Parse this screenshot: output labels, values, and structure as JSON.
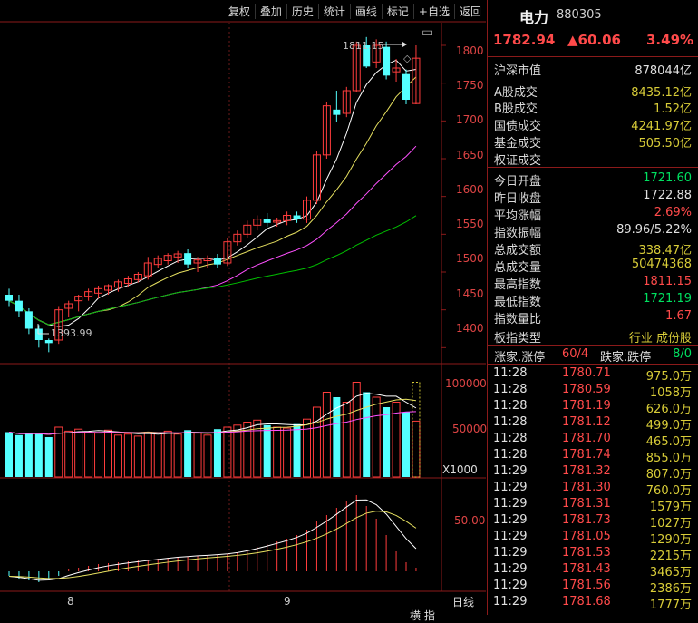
{
  "toolbar": {
    "items": [
      "复权",
      "叠加",
      "历史",
      "统计",
      "画线",
      "标记",
      "+自选",
      "返回"
    ]
  },
  "chart": {
    "price_axis": [
      "1800",
      "1750",
      "1700",
      "1650",
      "1600",
      "1550",
      "1500",
      "1450",
      "1400"
    ],
    "high_label": "1811.15",
    "low_label": "1393.99",
    "volume_axis": [
      "100000",
      "50000"
    ],
    "volume_unit": "X1000",
    "macd_axis": [
      "50.00"
    ],
    "date_labels": [
      "8",
      "9"
    ],
    "period_label": "日线",
    "bottom_partial": "横 指",
    "colors": {
      "up": "#ff3c3c",
      "down": "#54ffff",
      "ma5": "#ffffff",
      "ma10": "#e6e060",
      "ma20": "#ff50ff",
      "ma60": "#00c000"
    }
  },
  "chart_data": {
    "type": "candlestick",
    "ylim": [
      1380,
      1830
    ],
    "candles": [
      {
        "o": 1470,
        "h": 1478,
        "l": 1455,
        "c": 1462
      },
      {
        "o": 1462,
        "h": 1470,
        "l": 1440,
        "c": 1448
      },
      {
        "o": 1448,
        "h": 1452,
        "l": 1418,
        "c": 1425
      },
      {
        "o": 1425,
        "h": 1430,
        "l": 1400,
        "c": 1410
      },
      {
        "o": 1410,
        "h": 1412,
        "l": 1394,
        "c": 1406
      },
      {
        "o": 1410,
        "h": 1455,
        "l": 1405,
        "c": 1450
      },
      {
        "o": 1452,
        "h": 1462,
        "l": 1440,
        "c": 1458
      },
      {
        "o": 1462,
        "h": 1470,
        "l": 1448,
        "c": 1468
      },
      {
        "o": 1468,
        "h": 1478,
        "l": 1462,
        "c": 1474
      },
      {
        "o": 1472,
        "h": 1482,
        "l": 1465,
        "c": 1478
      },
      {
        "o": 1476,
        "h": 1484,
        "l": 1470,
        "c": 1482
      },
      {
        "o": 1480,
        "h": 1490,
        "l": 1474,
        "c": 1487
      },
      {
        "o": 1485,
        "h": 1495,
        "l": 1480,
        "c": 1491
      },
      {
        "o": 1490,
        "h": 1500,
        "l": 1486,
        "c": 1497
      },
      {
        "o": 1495,
        "h": 1520,
        "l": 1490,
        "c": 1512
      },
      {
        "o": 1510,
        "h": 1522,
        "l": 1505,
        "c": 1518
      },
      {
        "o": 1515,
        "h": 1525,
        "l": 1510,
        "c": 1522
      },
      {
        "o": 1520,
        "h": 1528,
        "l": 1512,
        "c": 1524
      },
      {
        "o": 1525,
        "h": 1530,
        "l": 1505,
        "c": 1510
      },
      {
        "o": 1512,
        "h": 1520,
        "l": 1500,
        "c": 1516
      },
      {
        "o": 1515,
        "h": 1522,
        "l": 1505,
        "c": 1518
      },
      {
        "o": 1518,
        "h": 1524,
        "l": 1505,
        "c": 1510
      },
      {
        "o": 1512,
        "h": 1545,
        "l": 1508,
        "c": 1540
      },
      {
        "o": 1540,
        "h": 1555,
        "l": 1535,
        "c": 1550
      },
      {
        "o": 1550,
        "h": 1568,
        "l": 1545,
        "c": 1562
      },
      {
        "o": 1562,
        "h": 1575,
        "l": 1555,
        "c": 1570
      },
      {
        "o": 1570,
        "h": 1578,
        "l": 1560,
        "c": 1565
      },
      {
        "o": 1566,
        "h": 1572,
        "l": 1560,
        "c": 1568
      },
      {
        "o": 1568,
        "h": 1580,
        "l": 1562,
        "c": 1575
      },
      {
        "o": 1575,
        "h": 1580,
        "l": 1565,
        "c": 1570
      },
      {
        "o": 1570,
        "h": 1600,
        "l": 1565,
        "c": 1595
      },
      {
        "o": 1595,
        "h": 1660,
        "l": 1590,
        "c": 1655
      },
      {
        "o": 1655,
        "h": 1725,
        "l": 1650,
        "c": 1720
      },
      {
        "o": 1715,
        "h": 1740,
        "l": 1698,
        "c": 1708
      },
      {
        "o": 1710,
        "h": 1745,
        "l": 1705,
        "c": 1740
      },
      {
        "o": 1740,
        "h": 1805,
        "l": 1738,
        "c": 1800
      },
      {
        "o": 1800,
        "h": 1811,
        "l": 1770,
        "c": 1772
      },
      {
        "o": 1778,
        "h": 1808,
        "l": 1770,
        "c": 1800
      },
      {
        "o": 1798,
        "h": 1805,
        "l": 1755,
        "c": 1760
      },
      {
        "o": 1765,
        "h": 1782,
        "l": 1752,
        "c": 1770
      },
      {
        "o": 1762,
        "h": 1768,
        "l": 1722,
        "c": 1728
      },
      {
        "o": 1723,
        "h": 1800,
        "l": 1722,
        "c": 1783
      }
    ],
    "volumes": [
      45,
      42,
      44,
      43,
      40,
      50,
      46,
      48,
      45,
      44,
      47,
      42,
      43,
      41,
      45,
      44,
      46,
      43,
      47,
      44,
      42,
      48,
      50,
      52,
      55,
      57,
      52,
      50,
      49,
      53,
      58,
      70,
      85,
      80,
      75,
      95,
      85,
      80,
      70,
      75,
      65,
      56
    ],
    "last_volume_outline": 95,
    "macd_bars": [
      -5,
      -8,
      -10,
      -12,
      -8,
      -5,
      2,
      4,
      6,
      8,
      9,
      10,
      11,
      12,
      13,
      14,
      15,
      16,
      16,
      17,
      17,
      18,
      19,
      21,
      24,
      27,
      30,
      33,
      36,
      40,
      46,
      55,
      62,
      70,
      78,
      84,
      72,
      58,
      40,
      22,
      10,
      4
    ]
  },
  "info": {
    "name": "电力",
    "code": "880305",
    "price": "1782.94",
    "change": "▲60.06",
    "change_pct": "3.49%",
    "market_cap_label": "沪深市值",
    "market_cap": "878044亿",
    "rows1": [
      {
        "k": "A股成交",
        "v": "8435.12亿"
      },
      {
        "k": "B股成交",
        "v": "1.52亿"
      },
      {
        "k": "国债成交",
        "v": "4241.97亿"
      },
      {
        "k": "基金成交",
        "v": "505.50亿"
      },
      {
        "k": "权证成交",
        "v": ""
      }
    ],
    "rows2": [
      {
        "k": "今日开盘",
        "v": "1721.60",
        "c": "grn"
      },
      {
        "k": "昨日收盘",
        "v": "1722.88",
        "c": "wht"
      },
      {
        "k": "平均涨幅",
        "v": "2.69%",
        "c": "red"
      },
      {
        "k": "指数振幅",
        "v": "89.96/5.22%",
        "c": "wht"
      },
      {
        "k": "总成交额",
        "v": "338.47亿",
        "c": "yel"
      },
      {
        "k": "总成交量",
        "v": "50474368",
        "c": "yel"
      },
      {
        "k": "最高指数",
        "v": "1811.15",
        "c": "red"
      },
      {
        "k": "最低指数",
        "v": "1721.19",
        "c": "grn"
      },
      {
        "k": "指数量比",
        "v": "1.67",
        "c": "red"
      }
    ],
    "board_type_label": "板指类型",
    "board_type_value": "行业 成份股",
    "up_stop_label": "涨家.涨停",
    "up_stop_value": "60/4",
    "down_stop_label": "跌家.跌停",
    "down_stop_value": "8/0",
    "ticks": [
      {
        "t": "11:28",
        "p": "1780.71",
        "v": "975.0万"
      },
      {
        "t": "11:28",
        "p": "1780.59",
        "v": "1058万"
      },
      {
        "t": "11:28",
        "p": "1781.19",
        "v": "626.0万"
      },
      {
        "t": "11:28",
        "p": "1781.12",
        "v": "499.0万"
      },
      {
        "t": "11:28",
        "p": "1781.70",
        "v": "465.0万"
      },
      {
        "t": "11:28",
        "p": "1781.74",
        "v": "855.0万"
      },
      {
        "t": "11:29",
        "p": "1781.32",
        "v": "807.0万"
      },
      {
        "t": "11:29",
        "p": "1781.30",
        "v": "760.0万"
      },
      {
        "t": "11:29",
        "p": "1781.31",
        "v": "1579万"
      },
      {
        "t": "11:29",
        "p": "1781.73",
        "v": "1027万"
      },
      {
        "t": "11:29",
        "p": "1781.05",
        "v": "1290万"
      },
      {
        "t": "11:29",
        "p": "1781.53",
        "v": "2215万"
      },
      {
        "t": "11:29",
        "p": "1781.43",
        "v": "3465万"
      },
      {
        "t": "11:29",
        "p": "1781.56",
        "v": "2386万"
      },
      {
        "t": "11:29",
        "p": "1781.68",
        "v": "1777万"
      }
    ]
  }
}
